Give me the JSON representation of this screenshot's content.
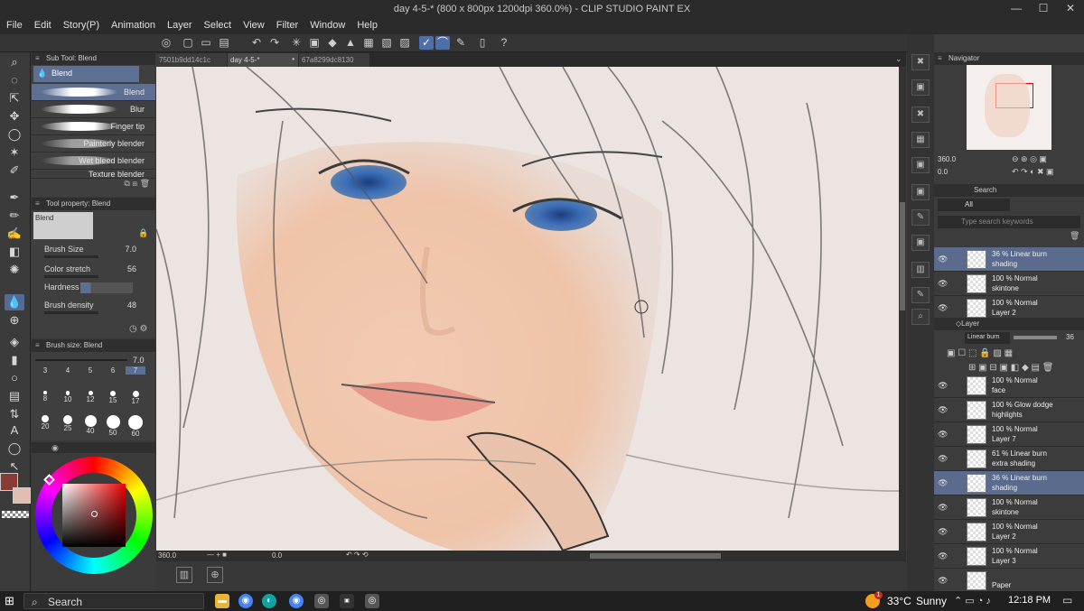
{
  "window": {
    "title": "day 4-5-* (800 x 800px 1200dpi 360.0%) - CLIP STUDIO PAINT EX",
    "minimize": "—",
    "maximize": "☐",
    "close": "✕"
  },
  "menu": [
    "File",
    "Edit",
    "Story(P)",
    "Animation",
    "Layer",
    "Select",
    "View",
    "Filter",
    "Window",
    "Help"
  ],
  "subtool": {
    "header": "Sub Tool: Blend",
    "group": "Blend",
    "brushes": [
      "Blend",
      "Blur",
      "Finger tip",
      "Painterly blender",
      "Wet bleed blender",
      "Texture blender"
    ]
  },
  "tool_property": {
    "header": "Tool property: Blend",
    "preview": "Blend",
    "brush_size": {
      "label": "Brush Size",
      "value": "7.0"
    },
    "color_stretch": {
      "label": "Color stretch",
      "value": "56"
    },
    "hardness": {
      "label": "Hardness"
    },
    "brush_density": {
      "label": "Brush density",
      "value": "48"
    }
  },
  "brush_size_panel": {
    "header": "Brush size: Blend",
    "value": "7.0",
    "sizes": [
      "3",
      "4",
      "5",
      "6",
      "7",
      "8",
      "10",
      "12",
      "15",
      "17",
      "20",
      "25",
      "40",
      "50",
      "60"
    ],
    "selected": "7"
  },
  "canvas_tabs": [
    "7501b9dd14c1c",
    "day 4-5-*",
    "67a8299dc8130"
  ],
  "canvas_status": {
    "zoom": "360.0",
    "angle": "0.0"
  },
  "navigator": {
    "header": "Navigator",
    "zoom": "360.0",
    "angle": "0.0"
  },
  "search_panel": {
    "tab": "Search",
    "filter": "All",
    "placeholder": "Type search keywords"
  },
  "top_layers": [
    {
      "line1": "36 % Linear burn",
      "line2": "shading",
      "selected": true
    },
    {
      "line1": "100 % Normal",
      "line2": "skintone",
      "selected": false
    },
    {
      "line1": "100 % Normal",
      "line2": "Layer 2",
      "selected": false
    }
  ],
  "layer_panel": {
    "tab": "Layer",
    "blend_mode": "Linear burn",
    "opacity": "36"
  },
  "layers": [
    {
      "line1": "100 % Normal",
      "line2": "face",
      "selected": false
    },
    {
      "line1": "100 % Glow dodge",
      "line2": "highlights",
      "selected": false
    },
    {
      "line1": "100 % Normal",
      "line2": "Layer 7",
      "selected": false
    },
    {
      "line1": "61 % Linear burn",
      "line2": "extra shading",
      "selected": false
    },
    {
      "line1": "36 % Linear burn",
      "line2": "shading",
      "selected": true
    },
    {
      "line1": "100 % Normal",
      "line2": "skintone",
      "selected": false
    },
    {
      "line1": "100 % Normal",
      "line2": "Layer 2",
      "selected": false
    },
    {
      "line1": "100 % Normal",
      "line2": "Layer 3",
      "selected": false
    },
    {
      "line1": "",
      "line2": "Paper",
      "selected": false
    }
  ],
  "taskbar": {
    "search": "Search",
    "temperature": "33°C",
    "weather": "Sunny",
    "time": "12:18 PM",
    "weather_badge": "1"
  },
  "colors": {
    "main": "#8a3b34",
    "sub": "#e0bfae",
    "accent": "#556b97"
  }
}
